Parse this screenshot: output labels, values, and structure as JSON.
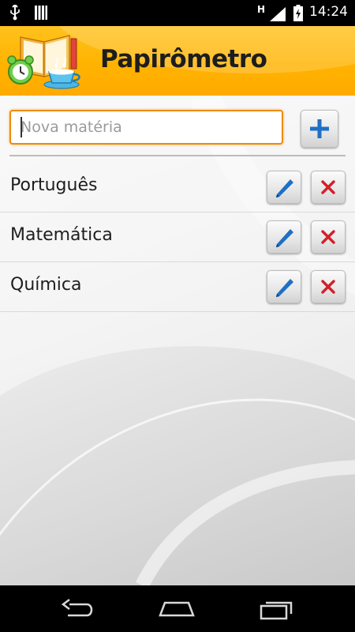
{
  "status_bar": {
    "time": "14:24",
    "network_label": "H",
    "icons": [
      "usb-icon",
      "signal-bars-icon",
      "cell-signal-icon",
      "battery-charging-icon"
    ]
  },
  "app": {
    "title": "Papirômetro",
    "logo": "app-logo-books-clock-cup"
  },
  "new_subject": {
    "placeholder": "Nova matéria",
    "value": "",
    "add_icon": "plus-icon"
  },
  "subjects": [
    {
      "label": "Português"
    },
    {
      "label": "Matemática"
    },
    {
      "label": "Química"
    }
  ],
  "colors": {
    "header": "#ffb300",
    "accent_orange": "#f08b00",
    "edit_icon": "#1f6fc4",
    "delete_icon": "#d1202a",
    "add_icon": "#1f6fc4"
  },
  "nav_bar": {
    "icons": [
      "back-icon",
      "home-icon",
      "recent-apps-icon"
    ]
  }
}
